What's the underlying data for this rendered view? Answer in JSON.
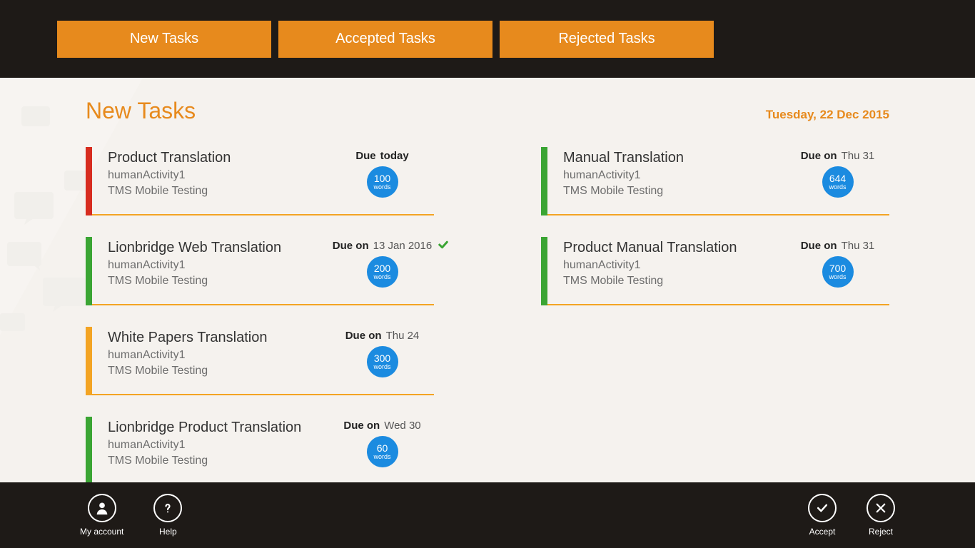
{
  "tabs": {
    "new": "New Tasks",
    "accepted": "Accepted Tasks",
    "rejected": "Rejected Tasks"
  },
  "page_title": "New Tasks",
  "current_date": "Tuesday, 22 Dec 2015",
  "tasks_left": [
    {
      "stripe": "red",
      "title": "Product Translation",
      "activity": "humanActivity1",
      "project": "TMS Mobile Testing",
      "due_prefix": "Due",
      "due_date": "today",
      "words": "100",
      "check": false
    },
    {
      "stripe": "green",
      "title": "Lionbridge Web Translation",
      "activity": "humanActivity1",
      "project": "TMS Mobile Testing",
      "due_prefix": "Due on",
      "due_date": "13 Jan 2016",
      "words": "200",
      "check": true
    },
    {
      "stripe": "orange",
      "title": "White Papers Translation",
      "activity": "humanActivity1",
      "project": "TMS Mobile Testing",
      "due_prefix": "Due on",
      "due_date": "Thu 24",
      "words": "300",
      "check": false
    },
    {
      "stripe": "green",
      "title": "Lionbridge Product Translation",
      "activity": "humanActivity1",
      "project": "TMS Mobile Testing",
      "due_prefix": "Due on",
      "due_date": "Wed 30",
      "words": "60",
      "check": false
    }
  ],
  "tasks_right": [
    {
      "stripe": "green",
      "title": "Manual Translation",
      "activity": "humanActivity1",
      "project": "TMS Mobile Testing",
      "due_prefix": "Due on",
      "due_date": "Thu 31",
      "words": "644",
      "check": false
    },
    {
      "stripe": "green",
      "title": "Product Manual Translation",
      "activity": "humanActivity1",
      "project": "TMS Mobile Testing",
      "due_prefix": "Due on",
      "due_date": "Thu 31",
      "words": "700",
      "check": false
    }
  ],
  "words_label": "words",
  "bottom": {
    "account": "My account",
    "help": "Help",
    "accept": "Accept",
    "reject": "Reject"
  }
}
